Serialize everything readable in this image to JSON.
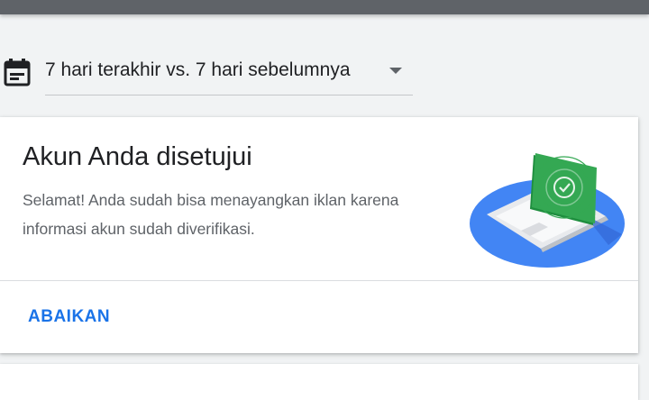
{
  "date_range": {
    "label": "7 hari terakhir vs. 7 hari sebelumnya",
    "icon": "calendar-icon",
    "dropdown_icon": "arrow-drop-down-icon"
  },
  "notification_card": {
    "title": "Akun Anda disetujui",
    "body": "Selamat! Anda sudah bisa menayangkan iklan karena informasi akun sudah diverifikasi.",
    "dismiss_label": "ABAIKAN",
    "illustration": "laptop-verified-illustration"
  },
  "colors": {
    "accent": "#1a73e8",
    "topbar": "#5f6368",
    "illustration_blue": "#4285f4",
    "illustration_green": "#34a853"
  }
}
